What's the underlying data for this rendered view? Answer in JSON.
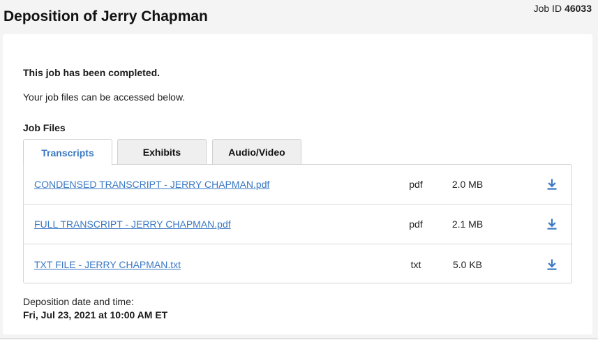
{
  "header": {
    "title": "Deposition of Jerry Chapman",
    "job_id_label": "Job ID",
    "job_id_value": "46033"
  },
  "status": {
    "heading": "This job has been completed.",
    "subtext": "Your job files can be accessed below."
  },
  "files_section": {
    "heading": "Job Files",
    "tabs": [
      {
        "label": "Transcripts",
        "active": true
      },
      {
        "label": "Exhibits",
        "active": false
      },
      {
        "label": "Audio/Video",
        "active": false
      }
    ],
    "files": [
      {
        "name": "CONDENSED TRANSCRIPT - JERRY CHAPMAN.pdf",
        "type": "pdf",
        "size": "2.0 MB",
        "icon": "download-icon"
      },
      {
        "name": "FULL TRANSCRIPT - JERRY CHAPMAN.pdf",
        "type": "pdf",
        "size": "2.1 MB",
        "icon": "download-icon"
      },
      {
        "name": "TXT FILE - JERRY CHAPMAN.txt",
        "type": "txt",
        "size": "5.0 KB",
        "icon": "download-icon"
      }
    ]
  },
  "deposition": {
    "date_label": "Deposition date and time:",
    "date_value": "Fri, Jul 23, 2021 at 10:00 AM ET"
  },
  "colors": {
    "link": "#3a78c3",
    "page_bg": "#f4f4f4",
    "card_bg": "#ffffff"
  }
}
